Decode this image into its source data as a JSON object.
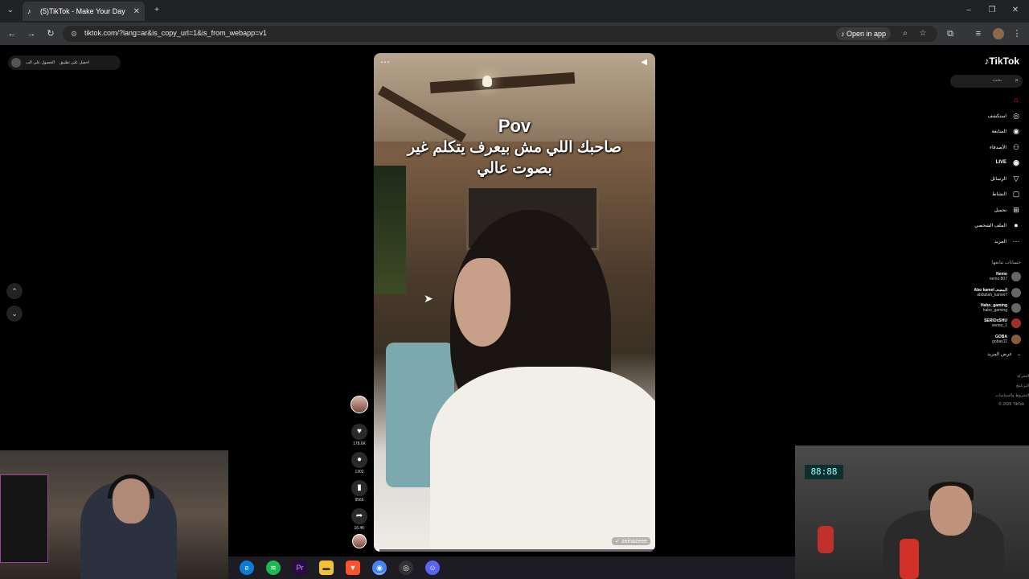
{
  "browser": {
    "tab_title": "(5)TikTok - Make Your Day",
    "tab_favicon": "tiktok-icon",
    "url": "tiktok.com/?lang=ar&is_copy_url=1&is_from_webapp=v1",
    "open_in_app": "Open in app"
  },
  "top_left": {
    "get_app": "احصل على تطبيق",
    "get_coins": "الحصول على الب"
  },
  "video": {
    "title_line": "Pov",
    "caption_line1": "صاحبك اللي مش بيعرف يتكلم غير",
    "caption_line2": "بصوت عالي",
    "handle": "zeinazeee",
    "progress": 0.02
  },
  "actions": {
    "likes": "178.6K",
    "comments": "1302",
    "saves": "9566",
    "shares": "16.4K"
  },
  "sidebar": {
    "logo": "TikTok",
    "search_placeholder": "بحث",
    "menu": [
      {
        "label": "",
        "icon": "home-icon"
      },
      {
        "label": "استكشف",
        "icon": "compass-icon"
      },
      {
        "label": "المتابعة",
        "icon": "following-icon"
      },
      {
        "label": "الأصدقاء",
        "icon": "friends-icon"
      },
      {
        "label": "LIVE",
        "icon": "live-icon"
      },
      {
        "label": "الرسائل",
        "icon": "messages-icon"
      },
      {
        "label": "النشاط",
        "icon": "activity-icon"
      },
      {
        "label": "تحميل",
        "icon": "upload-icon"
      },
      {
        "label": "الملف الشخصي",
        "icon": "profile-icon"
      },
      {
        "label": "المزيد",
        "icon": "more-icon"
      }
    ],
    "following_header": "حسابات تتابعها",
    "accounts": [
      {
        "username": "Nemo",
        "nickname": "nemo.807"
      },
      {
        "username": "Abo kamel المضحـ",
        "nickname": "abdullah_kamel7"
      },
      {
        "username": "Habo_gaming",
        "nickname": "habo_gaming"
      },
      {
        "username": "SERIOxSHU",
        "nickname": "serioo_1"
      },
      {
        "username": "GOBA",
        "nickname": "gobav11"
      }
    ],
    "see_more": "عرض المزيد",
    "footer": [
      "الشركة",
      "البرنامج",
      "الشروط والسياسات",
      "© 2026 TikTok"
    ]
  },
  "webcam_right": {
    "clock": "88:88"
  }
}
